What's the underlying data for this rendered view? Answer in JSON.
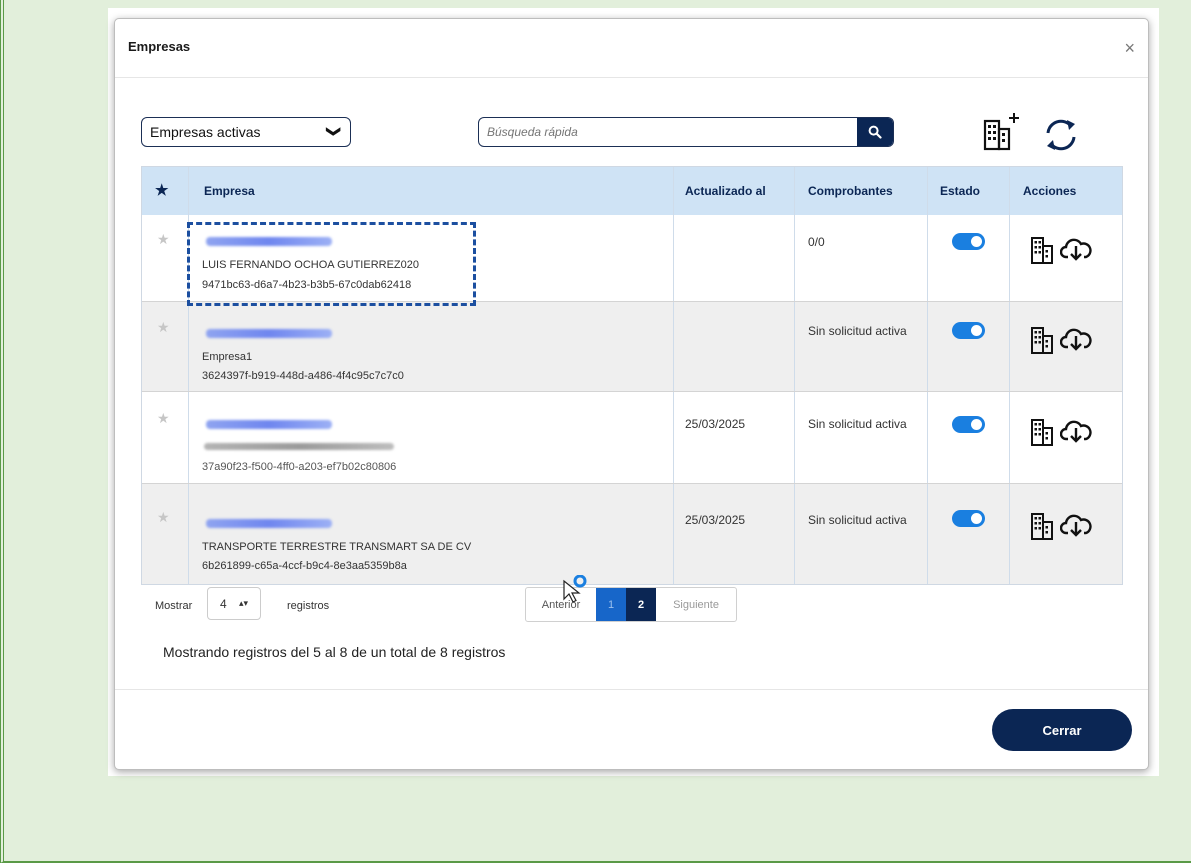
{
  "modal": {
    "title": "Empresas",
    "close_glyph": "×"
  },
  "toolbar": {
    "filter": {
      "selected": "Empresas activas",
      "chevron": "❯"
    },
    "search": {
      "placeholder": "Búsqueda rápida"
    },
    "icons": [
      "search-icon",
      "add-company-icon",
      "refresh-icon"
    ]
  },
  "table": {
    "columns": [
      {
        "key": "fav",
        "label": "★"
      },
      {
        "key": "empresa",
        "label": "Empresa"
      },
      {
        "key": "actualizado",
        "label": "Actualizado al"
      },
      {
        "key": "comprobantes",
        "label": "Comprobantes"
      },
      {
        "key": "estado",
        "label": "Estado"
      },
      {
        "key": "acciones",
        "label": "Acciones"
      }
    ],
    "rows": [
      {
        "name": "LUIS FERNANDO OCHOA GUTIERREZ020",
        "id": "9471bc63-d6a7-4b23-b3b5-67c0dab62418",
        "updated": "",
        "receipts": "0/0",
        "active": true,
        "highlighted": true
      },
      {
        "name": "Empresa1",
        "id": "3624397f-b919-448d-a486-4f4c95c7c7c0",
        "updated": "",
        "receipts": "Sin solicitud activa",
        "active": true
      },
      {
        "name": "",
        "id": "37a90f23-f500-4ff0-a203-ef7b02c80806",
        "updated": "25/03/2025",
        "receipts": "Sin solicitud activa",
        "active": true,
        "name_redacted": true
      },
      {
        "name": "TRANSPORTE TERRESTRE TRANSMART SA DE CV",
        "id": "6b261899-c65a-4ccf-b9c4-8e3aa5359b8a",
        "updated": "25/03/2025",
        "receipts": "Sin solicitud activa",
        "active": true
      }
    ]
  },
  "footer": {
    "show_label": "Mostrar",
    "page_size": "4",
    "page_size_arrows": "▴▾",
    "records_label": "registros",
    "pagination": {
      "prev": "Anterior",
      "pages": [
        "1",
        "2"
      ],
      "current": "2",
      "next": "Siguiente"
    },
    "info": "Mostrando registros del 5 al 8 de un total de 8 registros",
    "close_label": "Cerrar"
  },
  "colors": {
    "navy": "#0b2654",
    "toggle_on": "#1a7fe0",
    "header_bg": "#cfe3f5",
    "page_bg": "#e2efdb"
  }
}
